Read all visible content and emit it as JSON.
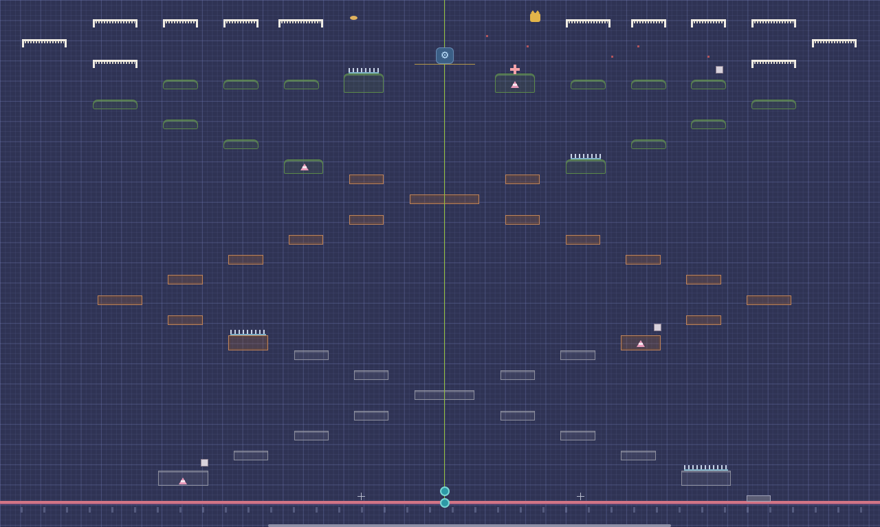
{
  "editor": {
    "grid": "on",
    "background_color": "#2f3354"
  },
  "colors": {
    "platform_white": "#f1ede4",
    "platform_green": "#5c8a4a",
    "platform_orange": "#c0845a",
    "platform_gray": "#8d8f9e",
    "ground": "#d27585",
    "center_line": "#95c23c",
    "player": "#2d9aa6"
  },
  "icons": {
    "hud": "gear-icon",
    "player": "player-orb-icon",
    "heal": "plus-icon",
    "cat": "cat-head-icon",
    "bird": "bird-icon",
    "enemy": "spiked-enemy-icon",
    "crosshair": "crosshair-icon"
  }
}
